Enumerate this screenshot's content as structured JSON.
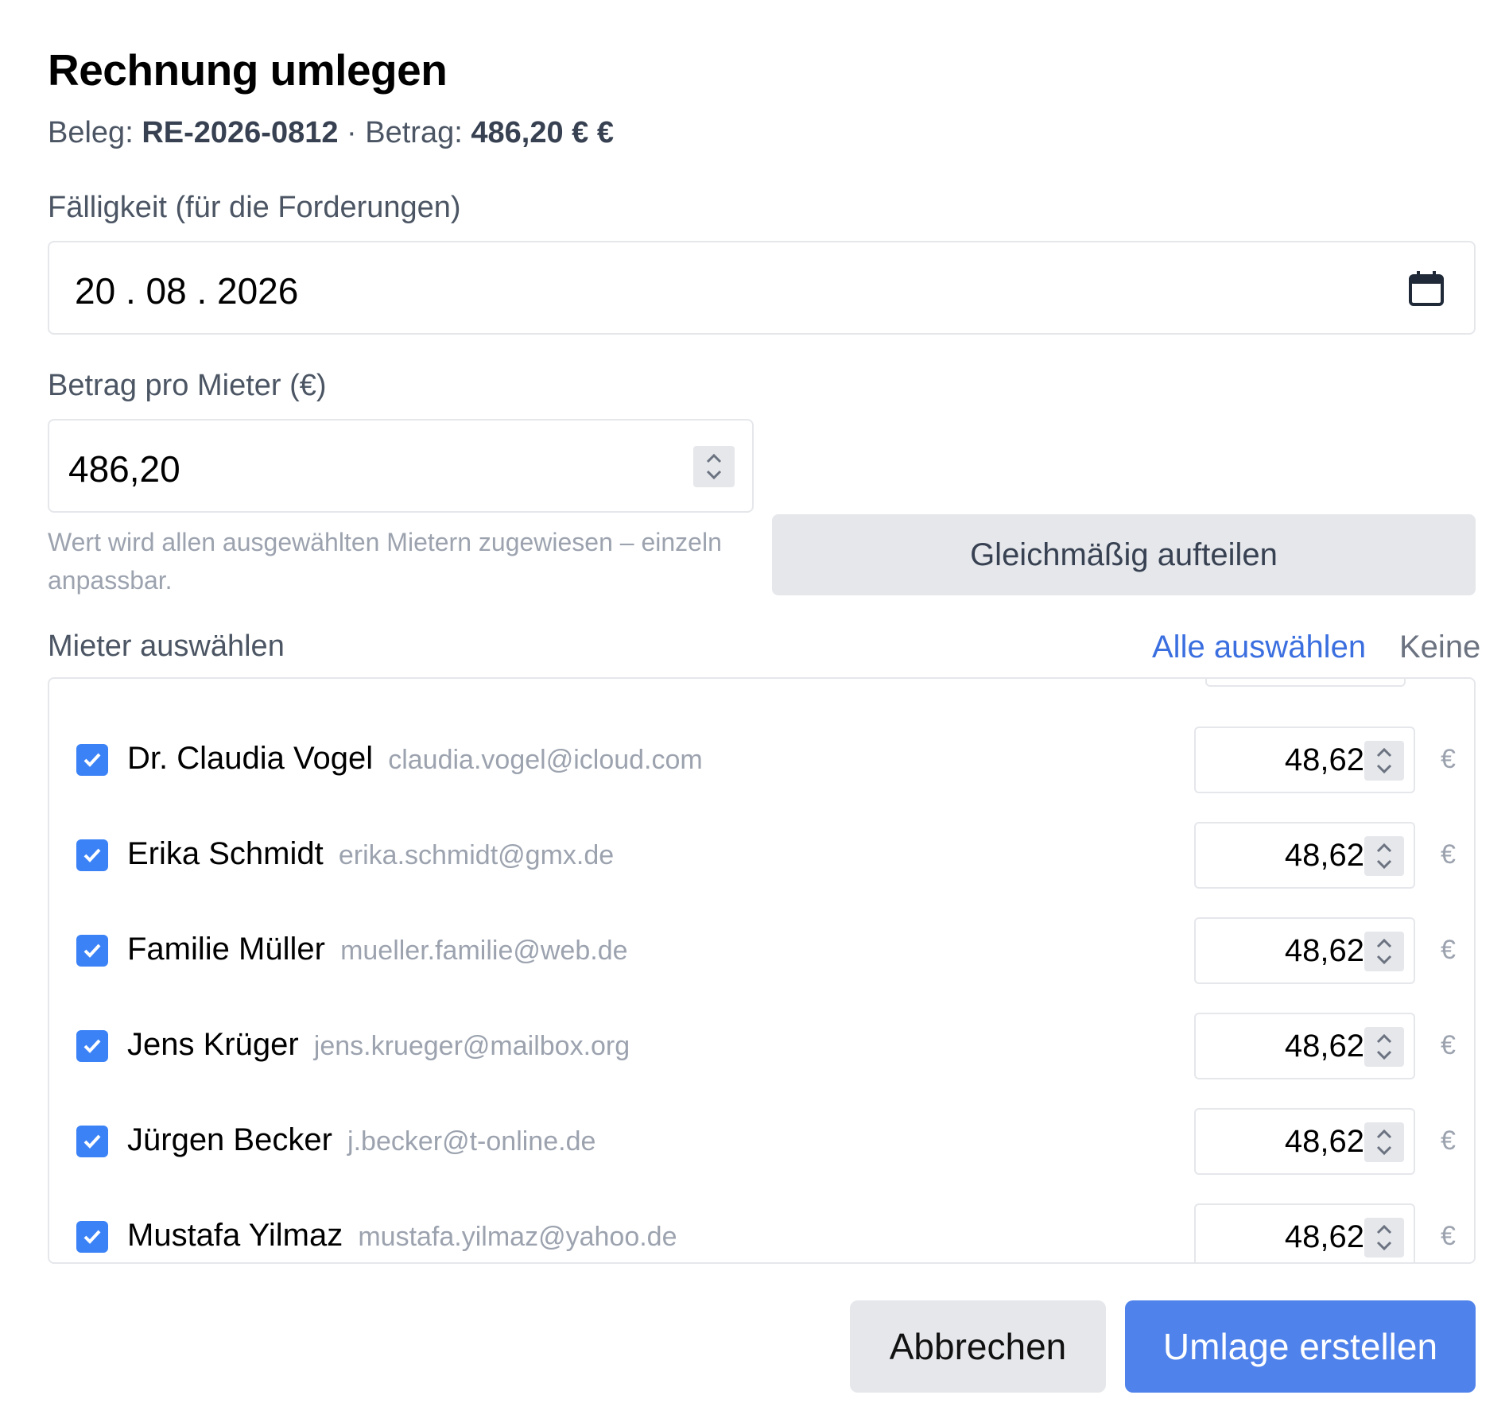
{
  "dialog": {
    "title": "Rechnung umlegen",
    "beleg_label": "Beleg:",
    "beleg_value": "RE-2026-0812",
    "separator": "·",
    "betrag_label": "Betrag:",
    "betrag_value": "486,20 € €"
  },
  "due_date": {
    "label": "Fälligkeit (für die Forderungen)",
    "value": "20 . 08 . 2026",
    "icon": "calendar-icon"
  },
  "amount_per_tenant": {
    "label": "Betrag pro Mieter (€)",
    "value": "486,20",
    "hint": "Wert wird allen ausgewählten Mietern zugewiesen – einzeln anpassbar.",
    "split_button": "Gleichmäßig aufteilen"
  },
  "tenants": {
    "label": "Mieter auswählen",
    "select_all": "Alle auswählen",
    "select_none": "Keine",
    "currency": "€",
    "items": [
      {
        "name": "Dr. Claudia Vogel",
        "email": "claudia.vogel@icloud.com",
        "amount": "48,62",
        "checked": true
      },
      {
        "name": "Erika Schmidt",
        "email": "erika.schmidt@gmx.de",
        "amount": "48,62",
        "checked": true
      },
      {
        "name": "Familie Müller",
        "email": "mueller.familie@web.de",
        "amount": "48,62",
        "checked": true
      },
      {
        "name": "Jens Krüger",
        "email": "jens.krueger@mailbox.org",
        "amount": "48,62",
        "checked": true
      },
      {
        "name": "Jürgen Becker",
        "email": "j.becker@t-online.de",
        "amount": "48,62",
        "checked": true
      },
      {
        "name": "Mustafa Yilmaz",
        "email": "mustafa.yilmaz@yahoo.de",
        "amount": "48,62",
        "checked": true
      }
    ]
  },
  "actions": {
    "cancel": "Abbrechen",
    "submit": "Umlage erstellen"
  },
  "colors": {
    "accent": "#4f82ea",
    "link": "#3b6fe0",
    "checkbox": "#3b82f6",
    "button_gray": "#e5e7eb"
  }
}
